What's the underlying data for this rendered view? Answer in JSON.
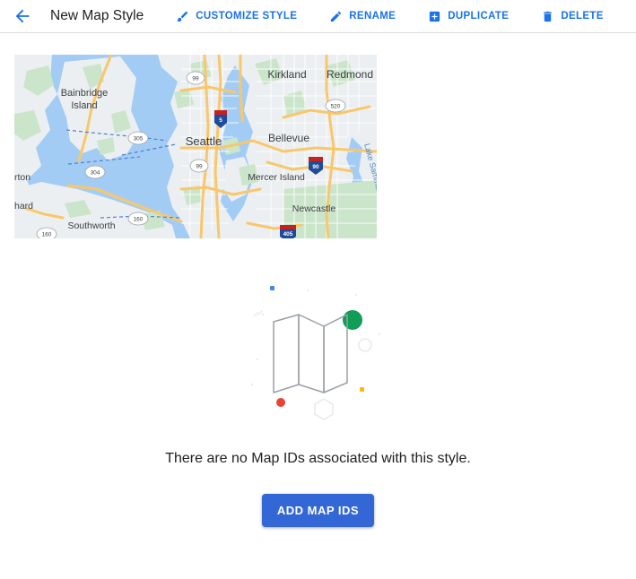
{
  "header": {
    "back_icon": "arrow-back-icon",
    "title": "New Map Style",
    "actions": [
      {
        "id": "customize-style",
        "label": "CUSTOMIZE STYLE",
        "icon": "brush-icon"
      },
      {
        "id": "rename",
        "label": "RENAME",
        "icon": "pencil-icon"
      },
      {
        "id": "duplicate",
        "label": "DUPLICATE",
        "icon": "add-box-icon"
      },
      {
        "id": "delete",
        "label": "DELETE",
        "icon": "trash-icon"
      }
    ],
    "accent_color": "#1a73e8",
    "title_color": "#202124",
    "divider_color": "#dadce0"
  },
  "map_preview": {
    "name": "map-style-preview",
    "region": "Seattle",
    "labels": [
      "Bainbridge Island",
      "Seattle",
      "Kirkland",
      "Redmond",
      "Bellevue",
      "Mercer Island",
      "Newcastle",
      "Southworth",
      "Lake Sammamish"
    ],
    "partial_labels": [
      "rton",
      "hard"
    ],
    "route_shields": [
      "99",
      "5",
      "305",
      "520",
      "304",
      "99",
      "90",
      "160",
      "160",
      "405"
    ],
    "colors": {
      "water": "#a3ccf5",
      "land": "#eceff1",
      "park": "#cde5cd",
      "highway": "#f9c76a",
      "road": "#ffffff",
      "interstate_shield": "#1f4b99",
      "ferry_line": "#4e7fd4"
    }
  },
  "empty_state": {
    "illustration_name": "folded-map-illustration",
    "message": "There are no Map IDs associated with this style.",
    "button_label": "ADD MAP IDS",
    "button_color": "#3367d6",
    "decor": {
      "blue_dot": "#4285f4",
      "green_dot": "#0f9d58",
      "red_dot": "#ea4335",
      "yellow_dot": "#fbbc05",
      "outline": "#e8eaed",
      "map_stroke": "#9aa0a6"
    }
  }
}
